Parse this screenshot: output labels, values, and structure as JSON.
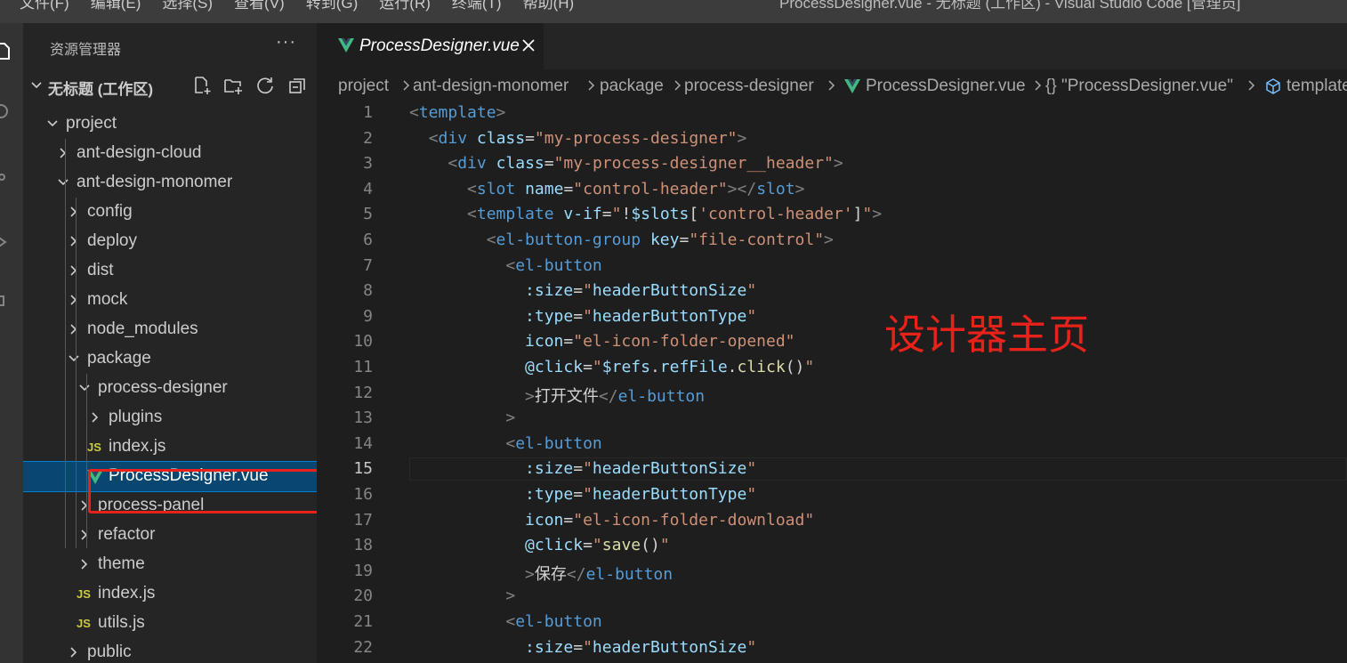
{
  "menu": [
    "文件(F)",
    "编辑(E)",
    "选择(S)",
    "查看(V)",
    "转到(G)",
    "运行(R)",
    "终端(T)",
    "帮助(H)"
  ],
  "window_title": "ProcessDesigner.vue - 无标题 (工作区) - Visual Studio Code [管理员]",
  "sidebar": {
    "title": "资源管理器",
    "more": "···",
    "workspace": "无标题 (工作区)",
    "tree": [
      {
        "label": "project",
        "kind": "folder-open"
      },
      {
        "label": "ant-design-cloud",
        "kind": "folder"
      },
      {
        "label": "ant-design-monomer",
        "kind": "folder-open"
      },
      {
        "label": "config",
        "kind": "folder"
      },
      {
        "label": "deploy",
        "kind": "folder"
      },
      {
        "label": "dist",
        "kind": "folder"
      },
      {
        "label": "mock",
        "kind": "folder"
      },
      {
        "label": "node_modules",
        "kind": "folder"
      },
      {
        "label": "package",
        "kind": "folder-open"
      },
      {
        "label": "process-designer",
        "kind": "folder-open"
      },
      {
        "label": "plugins",
        "kind": "folder"
      },
      {
        "label": "index.js",
        "kind": "js"
      },
      {
        "label": "ProcessDesigner.vue",
        "kind": "vue"
      },
      {
        "label": "process-panel",
        "kind": "folder"
      },
      {
        "label": "refactor",
        "kind": "folder"
      },
      {
        "label": "theme",
        "kind": "folder"
      },
      {
        "label": "index.js",
        "kind": "js"
      },
      {
        "label": "utils.js",
        "kind": "js"
      },
      {
        "label": "public",
        "kind": "folder"
      }
    ]
  },
  "tab": {
    "label": "ProcessDesigner.vue"
  },
  "js_badge": "JS",
  "breadcrumb": [
    "project",
    "ant-design-monomer",
    "package",
    "process-designer",
    "ProcessDesigner.vue",
    "{} \"ProcessDesigner.vue\"",
    "template"
  ],
  "editor": {
    "line_numbers": [
      "1",
      "2",
      "3",
      "4",
      "5",
      "6",
      "7",
      "8",
      "9",
      "10",
      "11",
      "12",
      "13",
      "14",
      "15",
      "16",
      "17",
      "18",
      "19",
      "20",
      "21",
      "22"
    ],
    "current_line": "15",
    "lines": [
      "<template>",
      "  <div class=\"my-process-designer\">",
      "    <div class=\"my-process-designer__header\">",
      "      <slot name=\"control-header\"></slot>",
      "      <template v-if=\"!$slots['control-header']\">",
      "        <el-button-group key=\"file-control\">",
      "          <el-button",
      "            :size=\"headerButtonSize\"",
      "            :type=\"headerButtonType\"",
      "            icon=\"el-icon-folder-opened\"",
      "            @click=\"$refs.refFile.click()\"",
      "            >打开文件</el-button",
      "          >",
      "          <el-button",
      "            :size=\"headerButtonSize\"",
      "            :type=\"headerButtonType\"",
      "            icon=\"el-icon-folder-download\"",
      "            @click=\"save()\"",
      "            >保存</el-button",
      "          >",
      "          <el-button",
      "            :size=\"headerButtonSize\""
    ]
  },
  "annotation": "设计器主页",
  "colors": {
    "accent_red": "#e8221b",
    "selection": "#094771",
    "vue_green": "#41b883"
  }
}
